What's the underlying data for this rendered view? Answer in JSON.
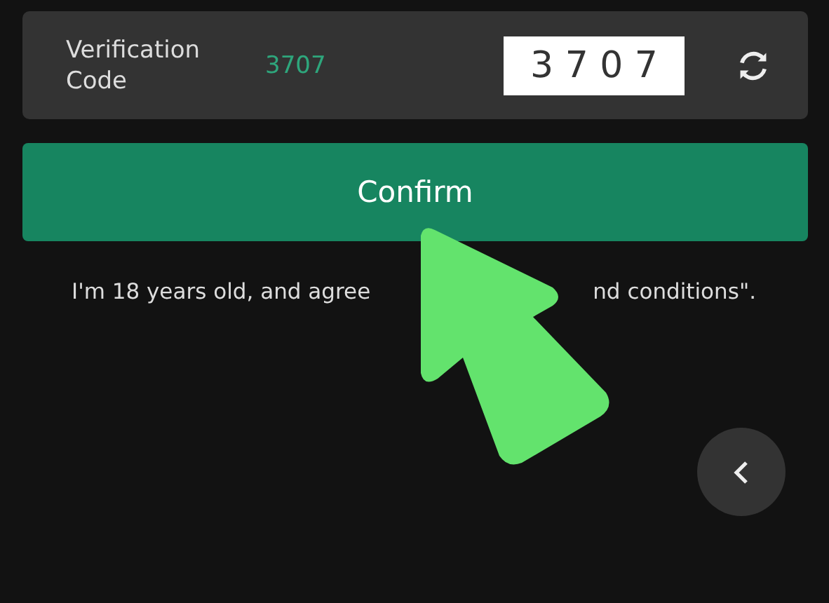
{
  "verification": {
    "label": "Verification Code",
    "code": "3707",
    "captcha": "3 7 0 7"
  },
  "confirm_button": "Confirm",
  "agreement_parts": [
    "I'm 18 years old, and agree",
    "nd conditions\"."
  ]
}
